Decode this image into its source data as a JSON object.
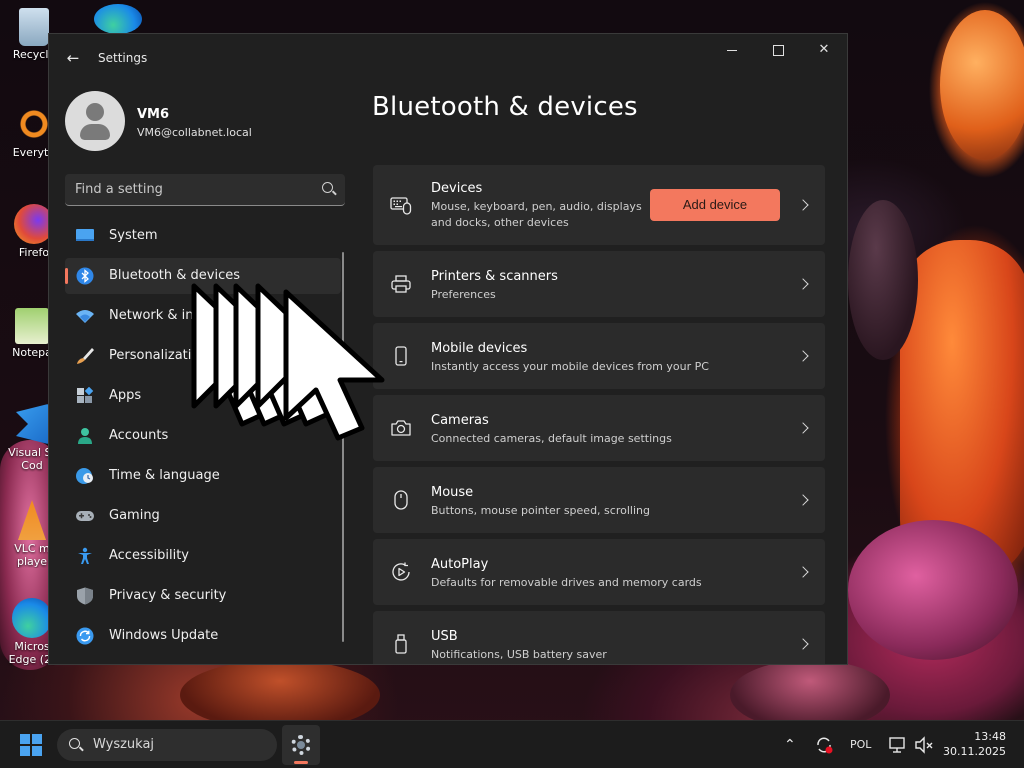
{
  "desktop": {
    "icons": [
      {
        "label": "Recycle"
      },
      {
        "label": "Everyth"
      },
      {
        "label": "Firefo"
      },
      {
        "label": "Notepa"
      },
      {
        "label": "Visual St",
        "label2": "Cod"
      },
      {
        "label": "VLC m",
        "label2": "playe"
      },
      {
        "label": "Micros",
        "label2": "Edge (2)"
      }
    ]
  },
  "window": {
    "title": "Settings",
    "back_icon": "back-arrow-icon",
    "controls": [
      "minimize",
      "maximize",
      "close"
    ]
  },
  "profile": {
    "name": "VM6",
    "email": "VM6@collabnet.local"
  },
  "search": {
    "placeholder": "Find a setting"
  },
  "nav": {
    "items": [
      {
        "label": "System",
        "icon": "system-icon",
        "color": "#4aa3f0"
      },
      {
        "label": "Bluetooth & devices",
        "icon": "bluetooth-icon",
        "color": "#2f87e8",
        "active": true
      },
      {
        "label": "Network & internet",
        "icon": "wifi-icon",
        "color": "#7ab8f5"
      },
      {
        "label": "Personalization",
        "icon": "brush-icon",
        "color": "#e8a860"
      },
      {
        "label": "Apps",
        "icon": "apps-icon",
        "color": "#a8b8c8"
      },
      {
        "label": "Accounts",
        "icon": "person-icon",
        "color": "#3ec4a0"
      },
      {
        "label": "Time & language",
        "icon": "globe-clock-icon",
        "color": "#5aa8e8"
      },
      {
        "label": "Gaming",
        "icon": "gamepad-icon",
        "color": "#a0a8b0"
      },
      {
        "label": "Accessibility",
        "icon": "accessibility-icon",
        "color": "#3a9af0"
      },
      {
        "label": "Privacy & security",
        "icon": "shield-icon",
        "color": "#9aa0a8"
      },
      {
        "label": "Windows Update",
        "icon": "update-icon",
        "color": "#3a9af0"
      }
    ]
  },
  "main": {
    "title": "Bluetooth & devices",
    "cards": [
      {
        "title": "Devices",
        "subtitle": "Mouse, keyboard, pen, audio, displays and docks, other devices",
        "icon": "devices-icon",
        "button": "Add device"
      },
      {
        "title": "Printers & scanners",
        "subtitle": "Preferences",
        "icon": "printer-icon"
      },
      {
        "title": "Mobile devices",
        "subtitle": "Instantly access your mobile devices from your PC",
        "icon": "phone-icon"
      },
      {
        "title": "Cameras",
        "subtitle": "Connected cameras, default image settings",
        "icon": "camera-icon"
      },
      {
        "title": "Mouse",
        "subtitle": "Buttons, mouse pointer speed, scrolling",
        "icon": "mouse-icon"
      },
      {
        "title": "AutoPlay",
        "subtitle": "Defaults for removable drives and memory cards",
        "icon": "autoplay-icon"
      },
      {
        "title": "USB",
        "subtitle": "Notifications, USB battery saver",
        "icon": "usb-icon"
      }
    ]
  },
  "colors": {
    "accent": "#f3785e",
    "window_bg": "#202020",
    "card_bg": "#2b2b2b"
  },
  "taskbar": {
    "search_text": "Wyszukaj",
    "language": "POL",
    "time": "13:48",
    "date": "30.11.2025"
  }
}
